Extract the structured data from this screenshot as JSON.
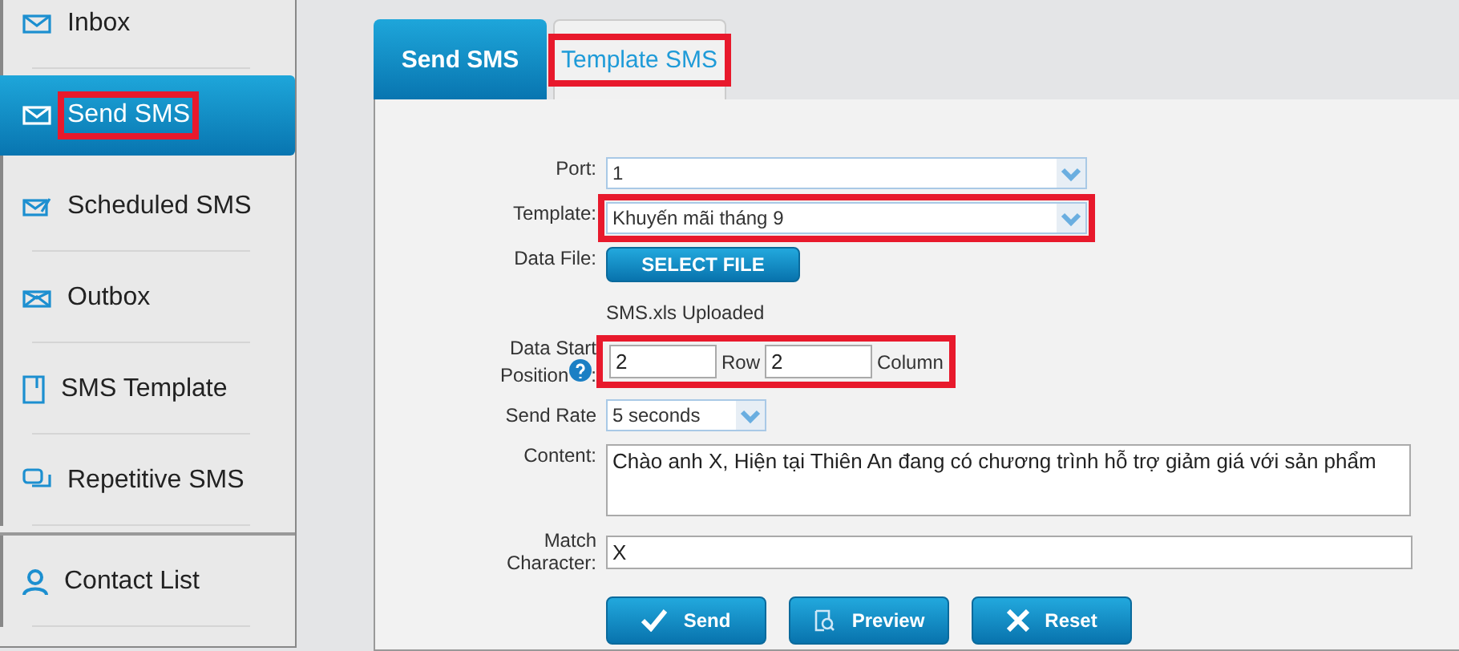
{
  "sidebar": {
    "items": [
      {
        "label": "Inbox",
        "selected": false,
        "highlighted": false
      },
      {
        "label": "Send SMS",
        "selected": true,
        "highlighted": true
      },
      {
        "label": "Scheduled SMS",
        "selected": false,
        "highlighted": false
      },
      {
        "label": "Outbox",
        "selected": false,
        "highlighted": false
      },
      {
        "label": "SMS Template",
        "selected": false,
        "highlighted": false
      },
      {
        "label": "Repetitive SMS",
        "selected": false,
        "highlighted": false
      }
    ],
    "footer_items": [
      {
        "label": "Contact List",
        "selected": false,
        "highlighted": false
      }
    ]
  },
  "tabs": [
    {
      "label": "Send SMS",
      "selected": true,
      "highlighted": false
    },
    {
      "label": "Template SMS",
      "selected": false,
      "highlighted": true
    }
  ],
  "form": {
    "port": {
      "label": "Port:",
      "value": "1"
    },
    "template": {
      "label": "Template:",
      "value": "Khuyến mãi tháng 9",
      "highlighted": true
    },
    "data_file": {
      "label": "Data File:",
      "button": "SELECT FILE",
      "status": "SMS.xls Uploaded"
    },
    "data_start": {
      "label_line1": "Data Start",
      "label_line2": "Position",
      "label_colon": ":",
      "row_value": "2",
      "row_label": "Row",
      "column_value": "2",
      "column_label": "Column",
      "highlighted": true
    },
    "send_rate": {
      "label": "Send Rate",
      "value": "5 seconds"
    },
    "content": {
      "label": "Content:",
      "value": "Chào anh X, Hiện tại Thiên An đang có chương trình hỗ trợ giảm giá với sản phẩm"
    },
    "match": {
      "label_line1": "Match",
      "label_line2": "Character:",
      "value": "X"
    },
    "buttons": [
      "Send",
      "Preview",
      "Reset"
    ]
  }
}
